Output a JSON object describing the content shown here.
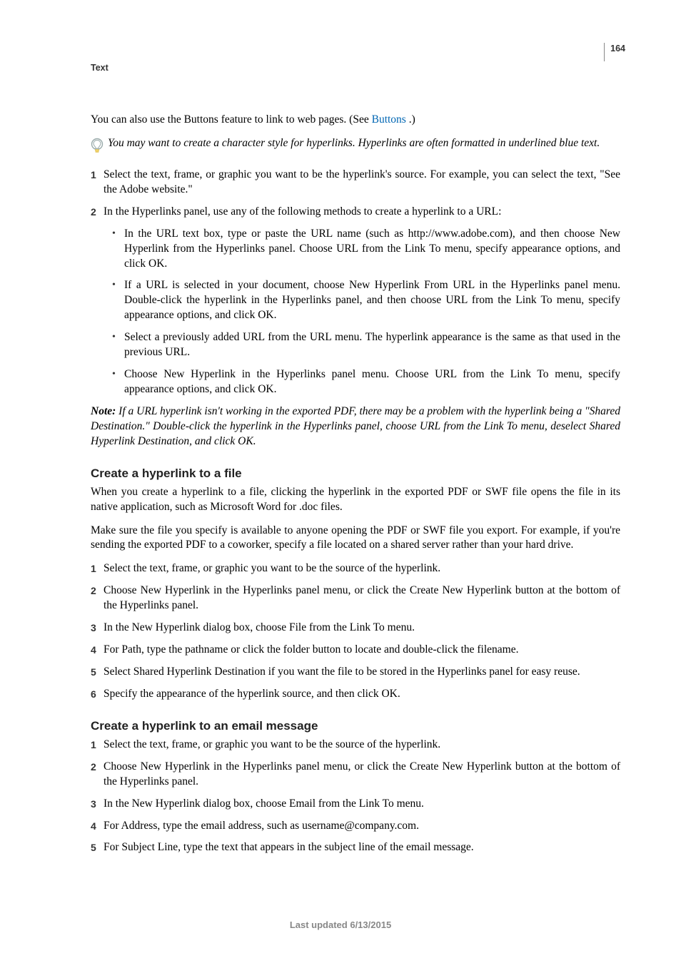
{
  "page_number": "164",
  "section_label": "Text",
  "intro_pre": "You can also use the Buttons feature to link to web pages. (See ",
  "intro_link": "Buttons",
  "intro_post": " .)",
  "tip_text": "You may want to create a character style for hyperlinks. Hyperlinks are often formatted in underlined blue text.",
  "s1": {
    "step1": "Select the text, frame, or graphic you want to be the hyperlink's source. For example, you can select the text, \"See the Adobe website.\"",
    "step2": "In the Hyperlinks panel, use any of the following methods to create a hyperlink to a URL:",
    "b1": "In the URL text box, type or paste the URL name (such as http://www.adobe.com), and then choose New Hyperlink from the Hyperlinks panel. Choose URL from the Link To menu, specify appearance options, and click OK.",
    "b2": "If a URL is selected in your document, choose New Hyperlink From URL in the Hyperlinks panel menu. Double-click the hyperlink in the Hyperlinks panel, and then choose URL from the Link To menu, specify appearance options, and click OK.",
    "b3": "Select a previously added URL from the URL menu. The hyperlink appearance is the same as that used in the previous URL.",
    "b4": "Choose New Hyperlink in the Hyperlinks panel menu. Choose URL from the Link To menu, specify appearance options, and click OK."
  },
  "note_label": "Note: ",
  "note_body": "If a URL hyperlink isn't working in the exported PDF, there may be a problem with the hyperlink being a \"Shared Destination.\" Double-click the hyperlink in the Hyperlinks panel, choose URL from the Link To menu, deselect Shared Hyperlink Destination, and click OK.",
  "s2": {
    "heading": "Create a hyperlink to a file",
    "p1": "When you create a hyperlink to a file, clicking the hyperlink in the exported PDF or SWF file opens the file in its native application, such as Microsoft Word for .doc files.",
    "p2": "Make sure the file you specify is available to anyone opening the PDF or SWF file you export. For example, if you're sending the exported PDF to a coworker, specify a file located on a shared server rather than your hard drive.",
    "step1": "Select the text, frame, or graphic you want to be the source of the hyperlink.",
    "step2": "Choose New Hyperlink in the Hyperlinks panel menu, or click the Create New Hyperlink button at the bottom of the Hyperlinks panel.",
    "step3": "In the New Hyperlink dialog box, choose File from the Link To menu.",
    "step4": "For Path, type the pathname or click the folder button to locate and double-click the filename.",
    "step5": "Select Shared Hyperlink Destination if you want the file to be stored in the Hyperlinks panel for easy reuse.",
    "step6": "Specify the appearance of the hyperlink source, and then click OK."
  },
  "s3": {
    "heading": "Create a hyperlink to an email message",
    "step1": "Select the text, frame, or graphic you want to be the source of the hyperlink.",
    "step2": "Choose New Hyperlink in the Hyperlinks panel menu, or click the Create New Hyperlink button at the bottom of the Hyperlinks panel.",
    "step3": "In the New Hyperlink dialog box, choose Email from the Link To menu.",
    "step4": "For Address, type the email address, such as username@company.com.",
    "step5": "For Subject Line, type the text that appears in the subject line of the email message."
  },
  "footer": "Last updated 6/13/2015"
}
